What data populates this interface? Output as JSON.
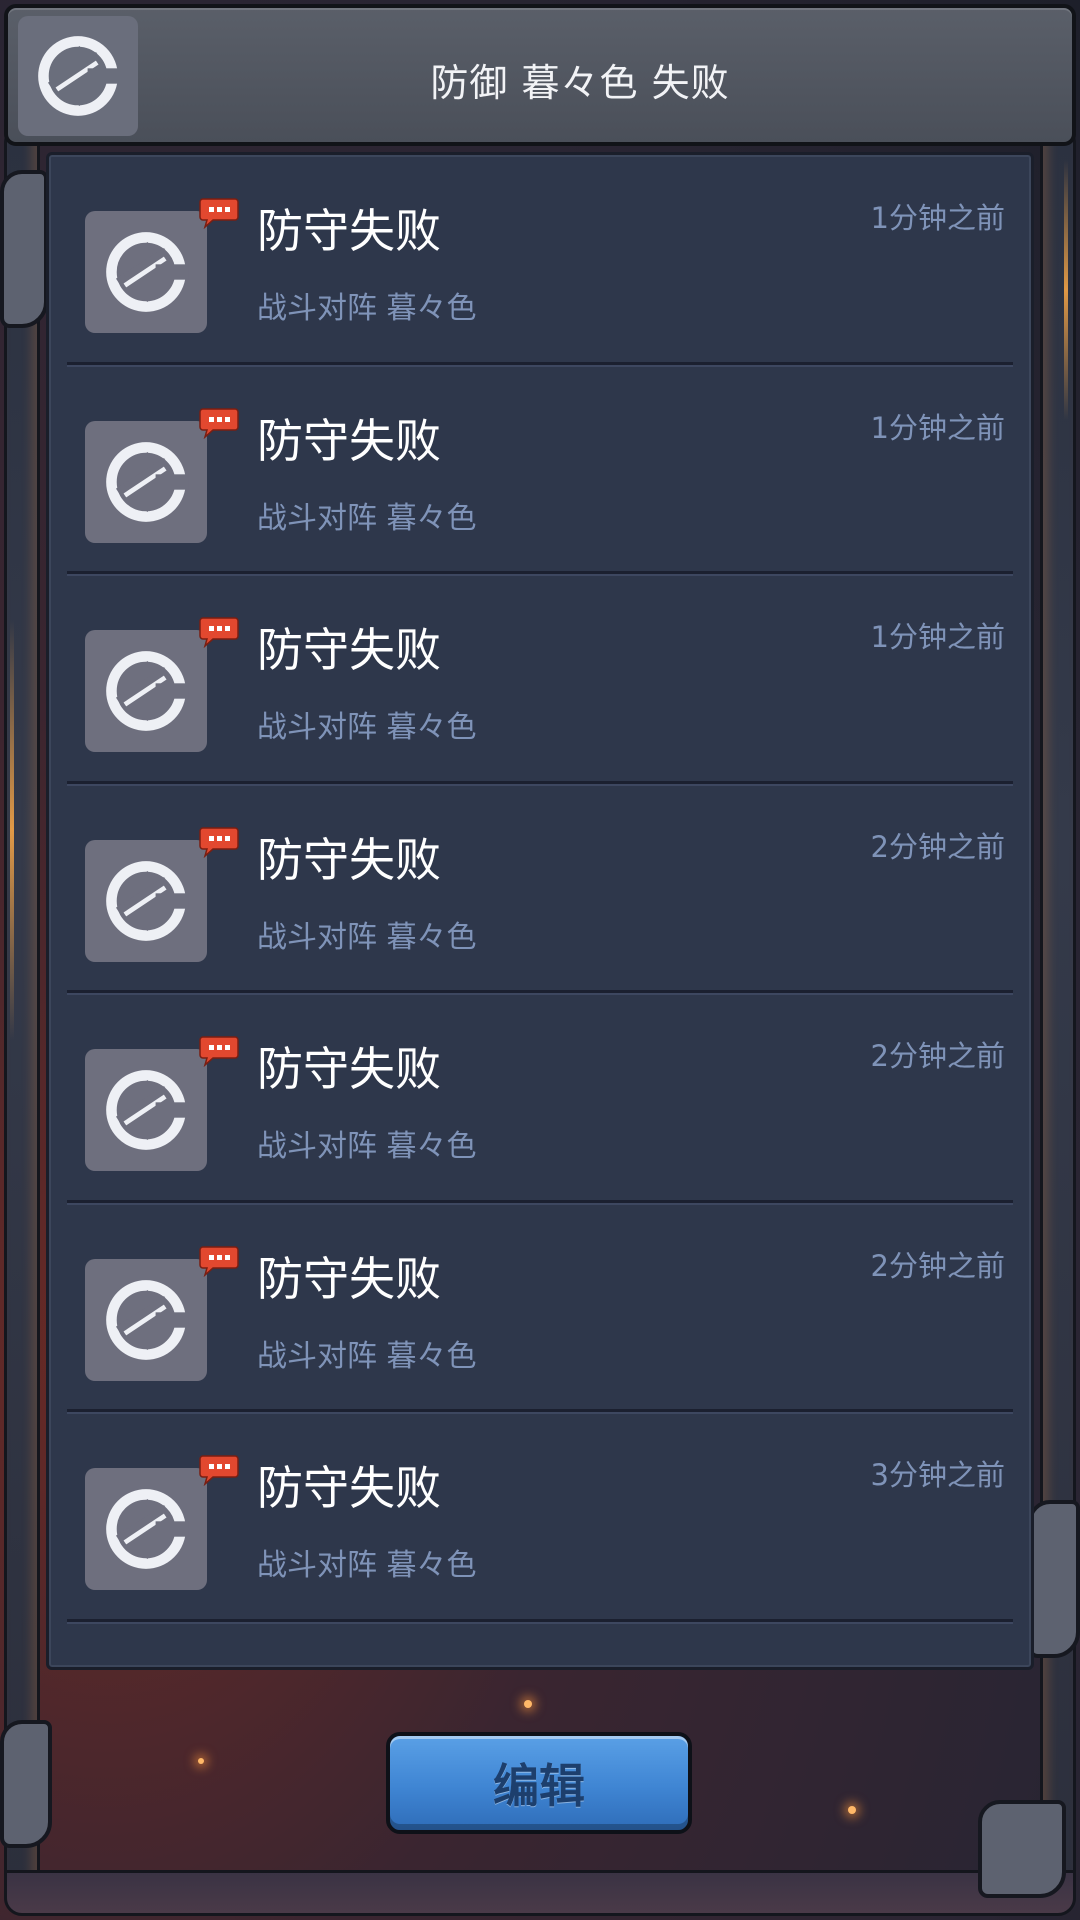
{
  "header": {
    "title": "防御 暮々色 失败",
    "icon": "defense-shield-icon"
  },
  "notifications": [
    {
      "title": "防守失败",
      "subtitle": "战斗对阵 暮々色",
      "time": "1分钟之前"
    },
    {
      "title": "防守失败",
      "subtitle": "战斗对阵 暮々色",
      "time": "1分钟之前"
    },
    {
      "title": "防守失败",
      "subtitle": "战斗对阵 暮々色",
      "time": "1分钟之前"
    },
    {
      "title": "防守失败",
      "subtitle": "战斗对阵 暮々色",
      "time": "2分钟之前"
    },
    {
      "title": "防守失败",
      "subtitle": "战斗对阵 暮々色",
      "time": "2分钟之前"
    },
    {
      "title": "防守失败",
      "subtitle": "战斗对阵 暮々色",
      "time": "2分钟之前"
    },
    {
      "title": "防守失败",
      "subtitle": "战斗对阵 暮々色",
      "time": "3分钟之前"
    }
  ],
  "edit_button": {
    "label": "编辑"
  },
  "colors": {
    "panel": "#2e374b",
    "subtitle": "#7f93b8",
    "badge": "#e2482f",
    "button": "#3f85d3"
  }
}
